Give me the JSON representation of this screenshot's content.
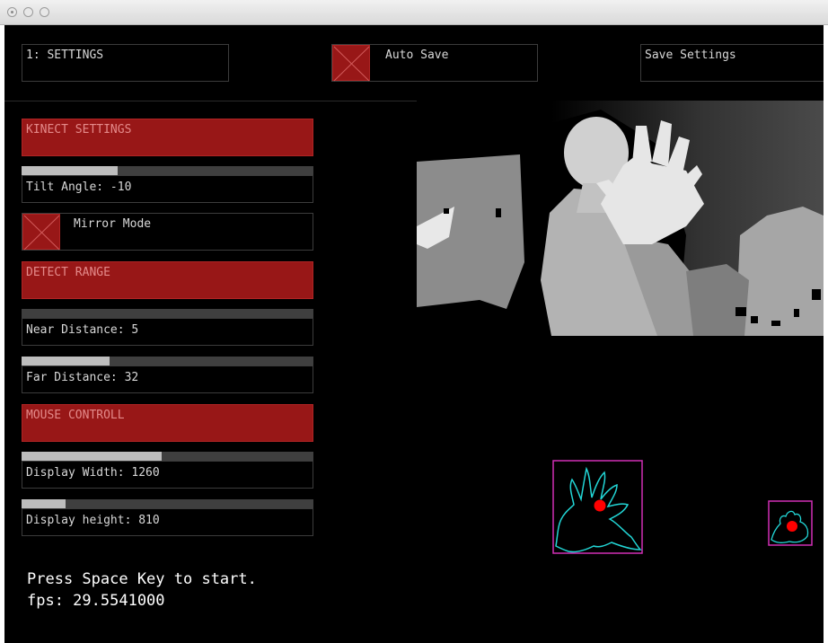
{
  "window": {
    "controls": [
      "close",
      "minimize",
      "zoom"
    ]
  },
  "top_bar": {
    "settings_tab": "1: SETTINGS",
    "auto_save_label": "Auto Save",
    "save_settings_label": "Save Settings"
  },
  "sidebar": {
    "kinect_header": "KINECT SETTINGS",
    "tilt_label": "Tilt Angle: -10",
    "tilt_fill_fraction": 0.33,
    "mirror_label": "Mirror Mode",
    "detect_header": "DETECT RANGE",
    "near_label": "Near Distance: 5",
    "near_fill_fraction": 0.0,
    "far_label": "Far Distance: 32",
    "far_fill_fraction": 0.3,
    "mouse_header": "MOUSE CONTROLL",
    "width_label": "Display Width: 1260",
    "width_fill_fraction": 0.48,
    "height_label": "Display height: 810",
    "height_fill_fraction": 0.15
  },
  "status": {
    "prompt": "Press Space Key to start.",
    "fps": "fps: 29.5541000"
  },
  "colors": {
    "accent_red": "#981717",
    "hand_outline": "#22d6d6",
    "hand_box": "#d12fb6",
    "hand_point": "#ff0000"
  }
}
